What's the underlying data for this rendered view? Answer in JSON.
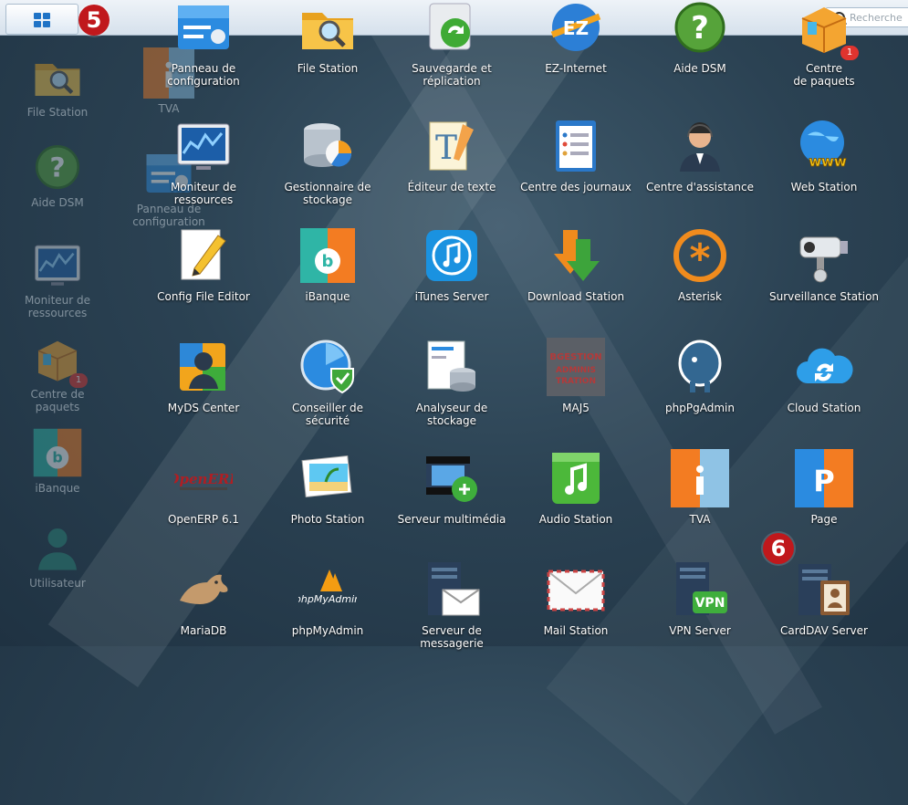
{
  "taskbar": {
    "marker_main_menu": "5",
    "search_placeholder": "Recherche"
  },
  "desktop_shortcuts": [
    {
      "label": "File Station",
      "icon": "folder-search-icon"
    },
    {
      "label": "TVA",
      "icon": "tva-icon"
    },
    {
      "label": "Aide DSM",
      "icon": "help-icon"
    },
    {
      "label": "Panneau de configuration",
      "icon": "control-panel-icon"
    },
    {
      "label": "Moniteur de ressources",
      "icon": "resource-monitor-icon"
    },
    {
      "label": "Centre de paquets",
      "icon": "package-center-icon",
      "badge": "1"
    },
    {
      "label": "iBanque",
      "icon": "ibanque-icon"
    },
    {
      "label": "Utilisateur",
      "icon": "user-icon"
    }
  ],
  "apps": [
    {
      "label": [
        "Panneau de",
        "configuration"
      ],
      "icon": "control-panel-icon"
    },
    {
      "label": [
        "File Station"
      ],
      "icon": "folder-search-icon"
    },
    {
      "label": [
        "Sauvegarde et",
        "réplication"
      ],
      "icon": "backup-icon"
    },
    {
      "label": [
        "EZ-Internet"
      ],
      "icon": "ez-internet-icon"
    },
    {
      "label": [
        "Aide DSM"
      ],
      "icon": "help-icon"
    },
    {
      "label": [
        "Centre",
        "de paquets"
      ],
      "icon": "package-center-icon",
      "badge": "1"
    },
    {
      "label": [
        "Moniteur de",
        "ressources"
      ],
      "icon": "resource-monitor-icon"
    },
    {
      "label": [
        "Gestionnaire de",
        "stockage"
      ],
      "icon": "storage-manager-icon"
    },
    {
      "label": [
        "Éditeur de texte"
      ],
      "icon": "text-editor-icon"
    },
    {
      "label": [
        "Centre des journaux"
      ],
      "icon": "log-center-icon"
    },
    {
      "label": [
        "Centre d'assistance"
      ],
      "icon": "support-center-icon"
    },
    {
      "label": [
        "Web Station"
      ],
      "icon": "web-station-icon"
    },
    {
      "label": [
        "Config File Editor"
      ],
      "icon": "config-file-editor-icon"
    },
    {
      "label": [
        "iBanque"
      ],
      "icon": "ibanque-icon"
    },
    {
      "label": [
        "iTunes Server"
      ],
      "icon": "itunes-server-icon"
    },
    {
      "label": [
        "Download Station"
      ],
      "icon": "download-station-icon"
    },
    {
      "label": [
        "Asterisk"
      ],
      "icon": "asterisk-icon"
    },
    {
      "label": [
        "Surveillance Station"
      ],
      "icon": "surveillance-station-icon"
    },
    {
      "label": [
        "MyDS Center"
      ],
      "icon": "myds-center-icon"
    },
    {
      "label": [
        "Conseiller de",
        "sécurité"
      ],
      "icon": "security-advisor-icon"
    },
    {
      "label": [
        "Analyseur de",
        "stockage"
      ],
      "icon": "storage-analyzer-icon"
    },
    {
      "label": [
        "MAJ5"
      ],
      "icon": "maj5-icon"
    },
    {
      "label": [
        "phpPgAdmin"
      ],
      "icon": "phppgadmin-icon"
    },
    {
      "label": [
        "Cloud Station"
      ],
      "icon": "cloud-station-icon"
    },
    {
      "label": [
        "OpenERP 6.1"
      ],
      "icon": "openerp-icon"
    },
    {
      "label": [
        "Photo Station"
      ],
      "icon": "photo-station-icon"
    },
    {
      "label": [
        "Serveur multimédia"
      ],
      "icon": "media-server-icon"
    },
    {
      "label": [
        "Audio Station"
      ],
      "icon": "audio-station-icon"
    },
    {
      "label": [
        "TVA"
      ],
      "icon": "tva-icon"
    },
    {
      "label": [
        "Page"
      ],
      "icon": "page-icon"
    },
    {
      "label": [
        "MariaDB"
      ],
      "icon": "mariadb-icon"
    },
    {
      "label": [
        "phpMyAdmin"
      ],
      "icon": "phpmyadmin-icon"
    },
    {
      "label": [
        "Serveur de",
        "messagerie"
      ],
      "icon": "mail-server-icon"
    },
    {
      "label": [
        "Mail Station"
      ],
      "icon": "mail-station-icon"
    },
    {
      "label": [
        "VPN Server"
      ],
      "icon": "vpn-server-icon"
    },
    {
      "label": [
        "CardDAV Server"
      ],
      "icon": "carddav-server-icon"
    }
  ],
  "marker_carddav": "6",
  "icon_text": {
    "openerp_logo": "OpenERP",
    "phpmyadmin_logo": "phpMyAdmin",
    "vpn_badge": "VPN",
    "web_station_logo": "www",
    "ez_logo": "EZ",
    "maj5_logo": "BGESTION ADMINISTRATION",
    "text_editor_glyph": "T"
  },
  "colors": {
    "accent_blue": "#1f73c6",
    "marker_red": "#c0181c",
    "badge_red": "#e0342f"
  }
}
